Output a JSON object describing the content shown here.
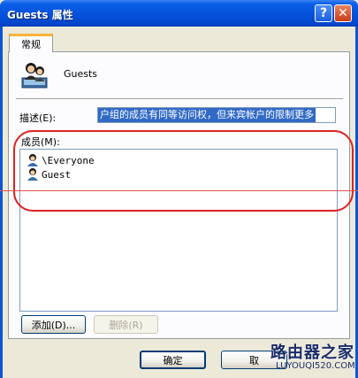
{
  "window": {
    "title": "Guests 属性",
    "help_label": "?",
    "close_label": "✕"
  },
  "tabs": [
    {
      "label": "常规",
      "active": true
    }
  ],
  "group": {
    "name": "Guests",
    "icon": "group-users-icon"
  },
  "description": {
    "label": "描述(E):",
    "value": "户组的成员有同等访问权，但来宾帐户的限制更多"
  },
  "members": {
    "label": "成员(M):",
    "items": [
      {
        "name": "\\Everyone",
        "icon": "user-icon"
      },
      {
        "name": "Guest",
        "icon": "user-icon"
      }
    ]
  },
  "buttons": {
    "add": "添加(D)...",
    "remove": "删除(R)",
    "ok": "确定",
    "cancel": "取"
  },
  "watermark": {
    "title": "路由器之家",
    "url": "LUYOUQI520.COM"
  },
  "colors": {
    "titlebar": "#0653dc",
    "selection": "#316ac5",
    "annotation": "#e02020"
  }
}
